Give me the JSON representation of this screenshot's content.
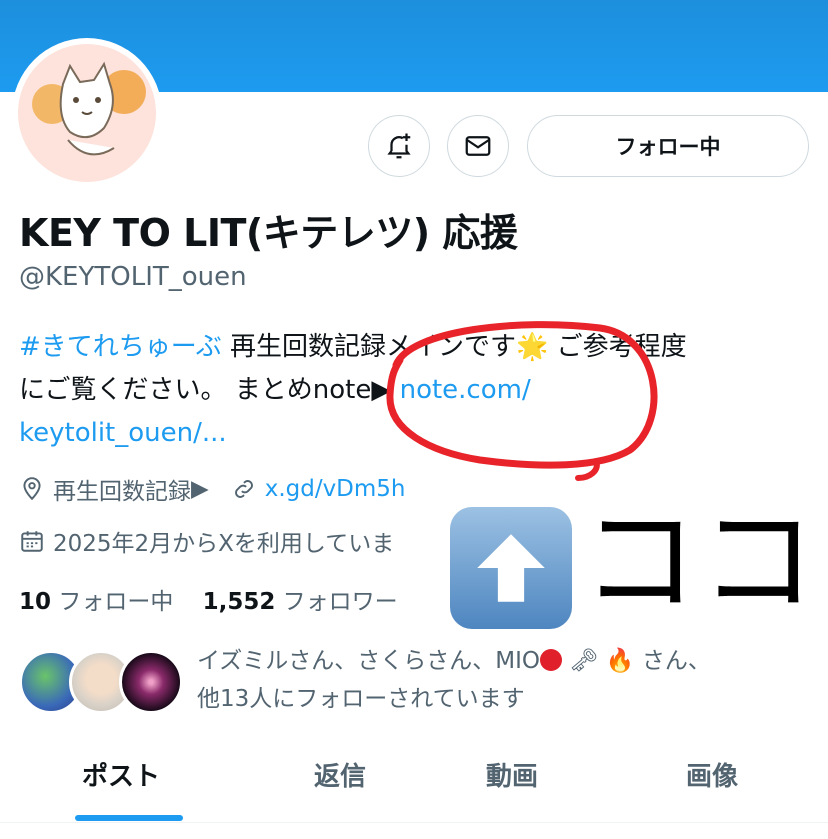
{
  "profile": {
    "name": "KEY TO LIT(キテレツ) 応援",
    "handle": "@KEYTOLIT_ouen",
    "bio_hashtag": "#きてれちゅーぶ",
    "bio_text1": " 再生回数記録メインです",
    "bio_text2": " ご参考程度",
    "bio_text3": "にご覧ください。 まとめnote",
    "bio_link1": "note.com/",
    "bio_link2": "keytolit_ouen/...",
    "location": "再生回数記録",
    "website": "x.gd/vDm5h",
    "joined": "2025年2月からXを利用していま",
    "following_count": "10",
    "following_label": "フォロー中",
    "followers_count": "1,552",
    "followers_label": "フォロワー",
    "followed_by_line1a": "イズミルさん、さくらさん、MIO",
    "followed_by_line1b": "さん、",
    "followed_by_line2": "他13人にフォローされています"
  },
  "actions": {
    "follow_label": "フォロー中"
  },
  "tabs": [
    {
      "label": "ポスト",
      "active": true
    },
    {
      "label": "返信",
      "active": false
    },
    {
      "label": "動画",
      "active": false
    },
    {
      "label": "画像",
      "active": false
    }
  ],
  "annotation": {
    "text": "ココ"
  },
  "colors": {
    "accent": "#1d9bf0",
    "banner": "#1d9bf0",
    "secondary_text": "#536471",
    "annotation_red": "#e8242a"
  }
}
